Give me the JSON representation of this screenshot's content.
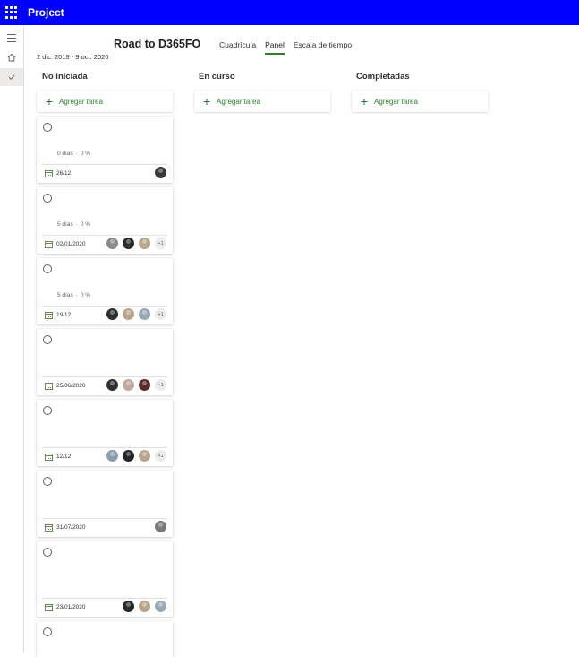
{
  "app": {
    "title": "Project"
  },
  "plan": {
    "title": "Road to D365FO",
    "dates": "2 dic. 2019 - 9 oct. 2020"
  },
  "tabs": [
    {
      "label": "Cuadrícula",
      "active": false
    },
    {
      "label": "Panel",
      "active": true
    },
    {
      "label": "Escala de tiempo",
      "active": false
    }
  ],
  "columns": [
    {
      "title": "No iniciada",
      "add_label": "Agregar tarea"
    },
    {
      "title": "En curso",
      "add_label": "Agregar tarea"
    },
    {
      "title": "Completadas",
      "add_label": "Agregar tarea"
    }
  ],
  "cards": [
    {
      "duration": "0 días",
      "percent": "0 %",
      "due": "26/12",
      "avatars": [
        "#3b3a39"
      ],
      "overflow": ""
    },
    {
      "duration": "5 días",
      "percent": "0 %",
      "due": "02/01/2020",
      "avatars": [
        "#8a8886",
        "#2b2b2b",
        "#b9a58e"
      ],
      "overflow": "+1"
    },
    {
      "duration": "5 días",
      "percent": "0 %",
      "due": "19/12",
      "avatars": [
        "#2f2f2f",
        "#b9a58e",
        "#9aa8b5"
      ],
      "overflow": "+1"
    },
    {
      "duration": "",
      "percent": "",
      "due": "25/06/2020",
      "avatars": [
        "#303030",
        "#c2a79a",
        "#5b2b2b"
      ],
      "overflow": "+1"
    },
    {
      "duration": "",
      "percent": "",
      "due": "12/12",
      "avatars": [
        "#8e9cb0",
        "#262626",
        "#b9a58e"
      ],
      "overflow": "+1"
    },
    {
      "duration": "",
      "percent": "",
      "due": "31/07/2020",
      "avatars": [
        "#7a7a7a"
      ],
      "overflow": ""
    },
    {
      "duration": "",
      "percent": "",
      "due": "23/01/2020",
      "avatars": [
        "#2b2b2b",
        "#b9a58e",
        "#9aa8b5"
      ],
      "overflow": ""
    },
    {
      "duration": "",
      "percent": "",
      "due": "",
      "avatars": [],
      "overflow": ""
    }
  ],
  "colors": {
    "header": "#0000ff",
    "accent": "#2f7d32"
  },
  "icons": {
    "app_launcher": "waffle-icon",
    "menu": "hamburger-icon",
    "home": "home-icon",
    "check": "check-icon",
    "add": "plus-icon",
    "complete": "circle-icon",
    "due": "calendar-icon"
  }
}
